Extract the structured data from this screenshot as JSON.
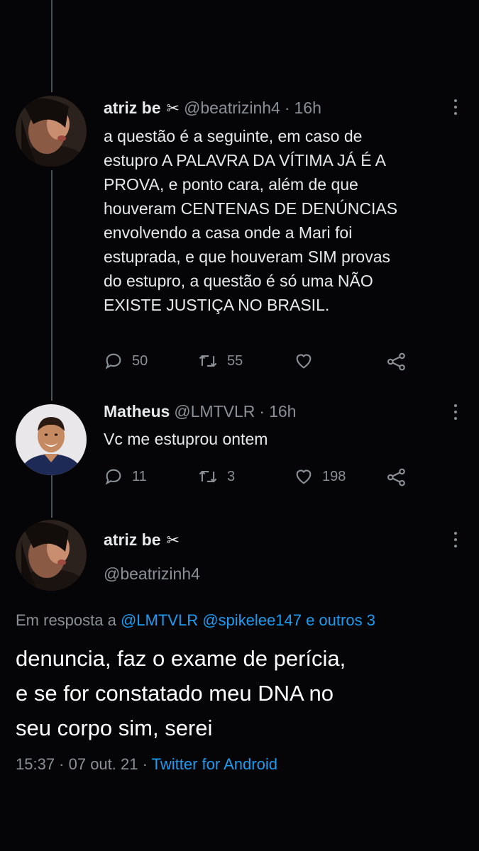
{
  "colors": {
    "background": "#050507",
    "text": "#e7e9ea",
    "muted": "#8b9096",
    "link": "#1d9bf0",
    "thread_line": "#4a4f55"
  },
  "tweet1": {
    "name": "atriz be",
    "badge_icon": "scissors-icon",
    "badge_glyph": "✂",
    "handle": "@beatrizinh4",
    "separator": "·",
    "time": "16h",
    "text_lines": [
      "a questão é a seguinte, em caso de",
      "estupro A PALAVRA DA VÍTIMA JÁ É A",
      "PROVA, e ponto cara, além de que",
      "houveram CENTENAS DE DENÚNCIAS",
      "envolvendo a casa onde a Mari foi",
      "estuprada, e que houveram SIM provas",
      "do estupro, a questão é só uma NÃO",
      "EXISTE JUSTIÇA NO BRASIL."
    ],
    "replies": "50",
    "retweets": "55",
    "likes": ""
  },
  "tweet2": {
    "name": "Matheus",
    "handle": "@LMTVLR",
    "separator": "·",
    "time": "16h",
    "text": "Vc me estuprou ontem",
    "replies": "11",
    "retweets": "3",
    "likes": "198"
  },
  "tweet3": {
    "name": "atriz be",
    "badge_icon": "scissors-icon",
    "badge_glyph": "✂",
    "handle": "@beatrizinh4",
    "reply_prefix": "Em resposta a",
    "reply_mentions": "@LMTVLR @spikelee147 e outros 3",
    "text_lines": [
      "denuncia, faz o exame de perícia,",
      "e se for constatado meu DNA no",
      "seu corpo sim, serei"
    ],
    "timestamp": "15:37 · 07 out. 21",
    "meta_sep": "·",
    "source": "Twitter for Android"
  }
}
